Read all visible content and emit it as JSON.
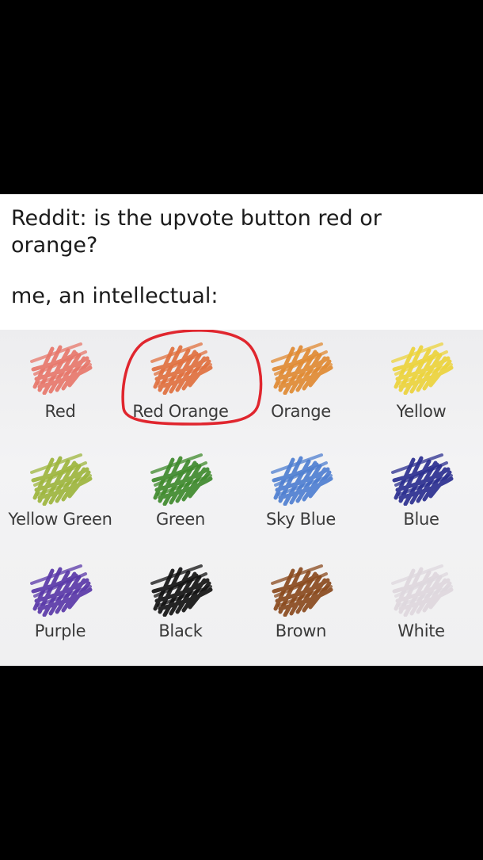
{
  "caption": {
    "question": "Reddit: is the upvote button red or orange?",
    "answer_intro": "me, an intellectual:"
  },
  "swatches": [
    {
      "label": "Red",
      "color": "#e7776b"
    },
    {
      "label": "Red Orange",
      "color": "#e0703f"
    },
    {
      "label": "Orange",
      "color": "#e08a33"
    },
    {
      "label": "Yellow",
      "color": "#ecd33c"
    },
    {
      "label": "Yellow Green",
      "color": "#9db53d"
    },
    {
      "label": "Green",
      "color": "#3f8a2c"
    },
    {
      "label": "Sky Blue",
      "color": "#4f7fd0"
    },
    {
      "label": "Blue",
      "color": "#2b2f8f"
    },
    {
      "label": "Purple",
      "color": "#5a38a8"
    },
    {
      "label": "Black",
      "color": "#121212"
    },
    {
      "label": "Brown",
      "color": "#8a4a1e"
    },
    {
      "label": "White",
      "color": "#ded7dd"
    }
  ],
  "highlight_color": "#e0262e"
}
